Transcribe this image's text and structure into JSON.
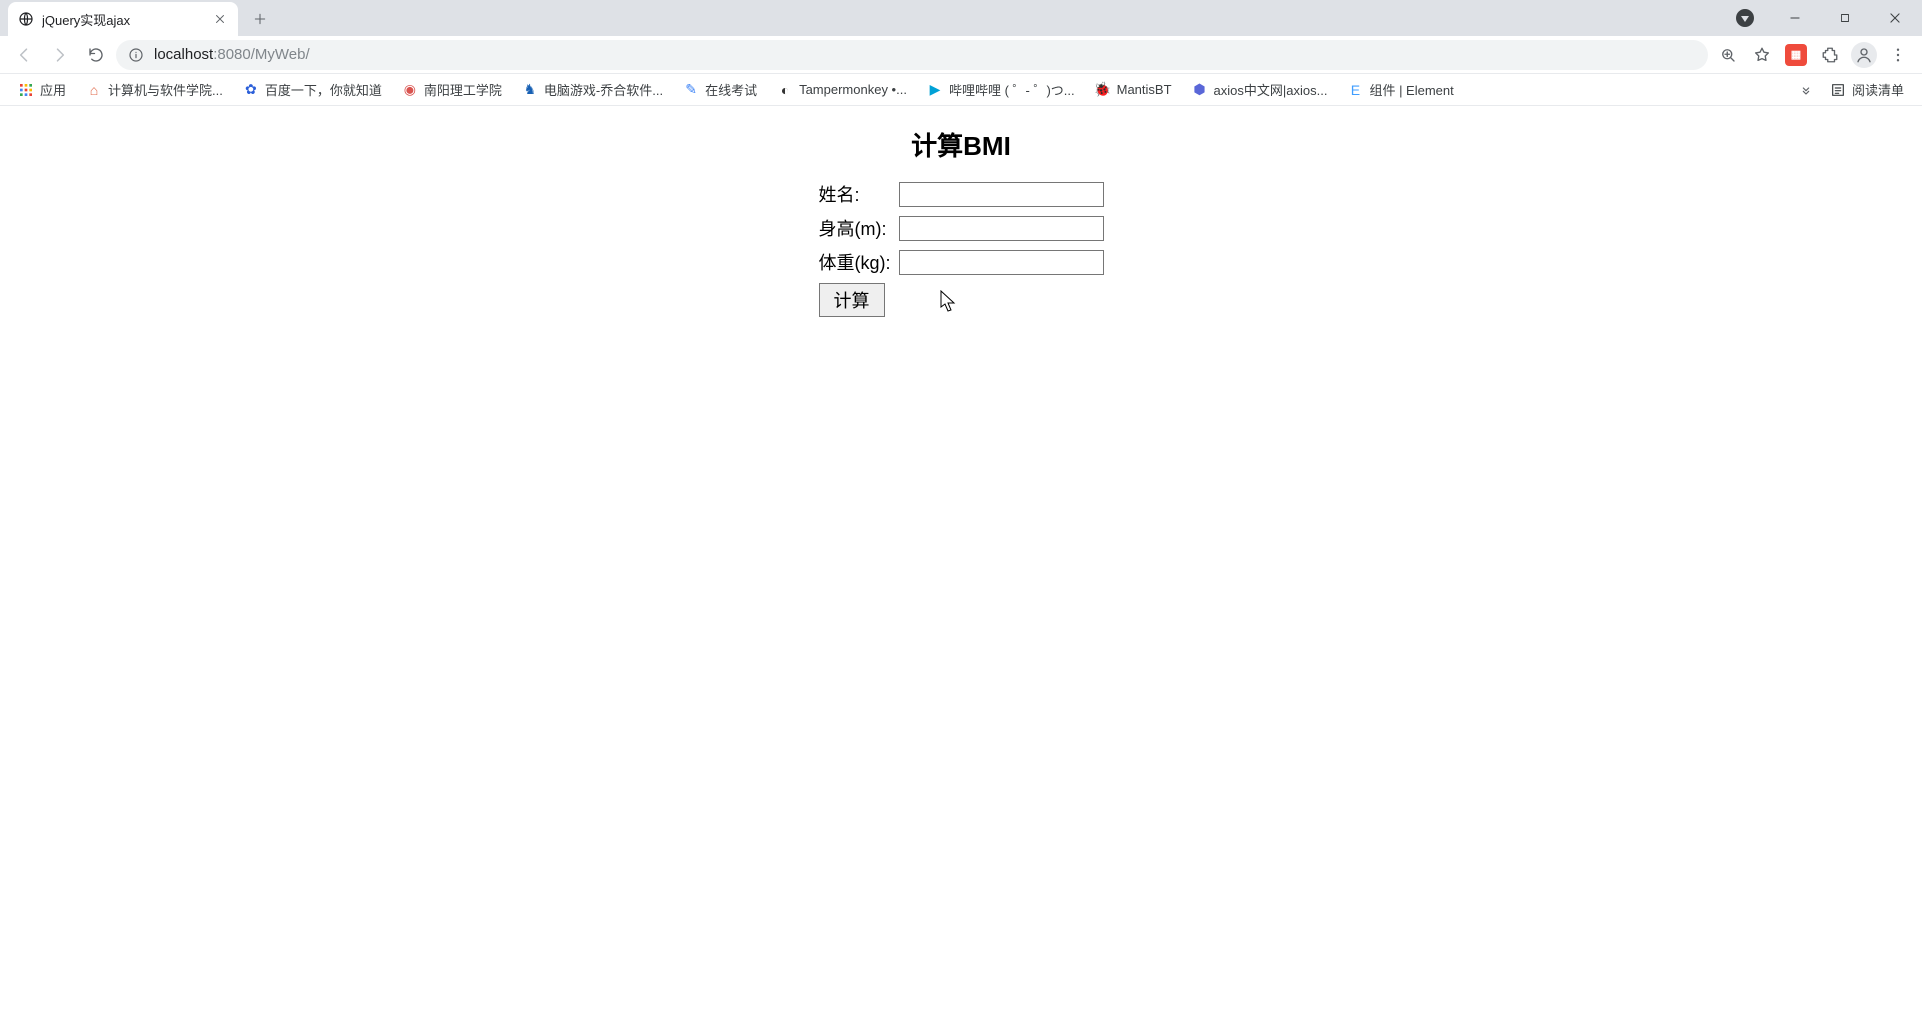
{
  "browser": {
    "tab_title": "jQuery实现ajax",
    "url_host": "localhost",
    "url_port": ":8080",
    "url_path": "/MyWeb/"
  },
  "bookmarks": {
    "apps_label": "应用",
    "items": [
      {
        "label": "计算机与软件学院...",
        "color": "#e06a4b",
        "glyph": "⌂"
      },
      {
        "label": "百度一下，你就知道",
        "color": "#2b5fd9",
        "glyph": "✿"
      },
      {
        "label": "南阳理工学院",
        "color": "#d9534f",
        "glyph": "◉"
      },
      {
        "label": "电脑游戏-乔合软件...",
        "color": "#1760b4",
        "glyph": "♞"
      },
      {
        "label": "在线考试",
        "color": "#3b82f6",
        "glyph": "✎"
      },
      {
        "label": "Tampermonkey •...",
        "color": "#333333",
        "glyph": "◐"
      },
      {
        "label": "哔哩哔哩 ( ゜- ゜)つ...",
        "color": "#00a1d6",
        "glyph": "▶"
      },
      {
        "label": "MantisBT",
        "color": "#8bbf3f",
        "glyph": "🐞"
      },
      {
        "label": "axios中文网|axios...",
        "color": "#5a67d8",
        "glyph": "⬢"
      },
      {
        "label": "组件 | Element",
        "color": "#409eff",
        "glyph": "E"
      }
    ],
    "reading_list": "阅读清单"
  },
  "page": {
    "heading": "计算BMI",
    "fields": [
      {
        "label": "姓名:",
        "value": ""
      },
      {
        "label": "身高(m):",
        "value": ""
      },
      {
        "label": "体重(kg):",
        "value": ""
      }
    ],
    "submit_label": "计算"
  }
}
